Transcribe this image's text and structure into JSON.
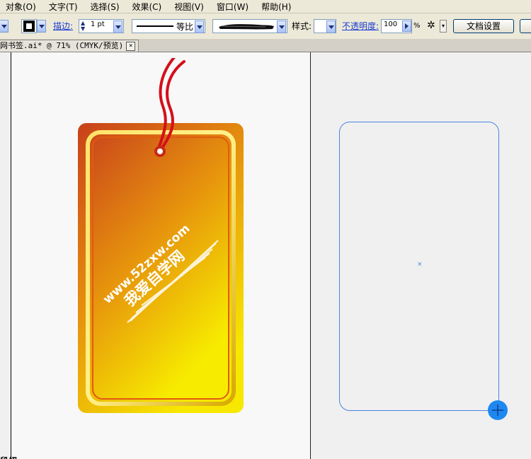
{
  "menu": [
    "对象(O)",
    "文字(T)",
    "选择(S)",
    "效果(C)",
    "视图(V)",
    "窗口(W)",
    "帮助(H)"
  ],
  "controlbar": {
    "stroke_label": "描边:",
    "stroke_weight": "1 pt",
    "profile_label": "等比",
    "style_label": "样式:",
    "opacity_label": "不透明度:",
    "opacity_value": "100",
    "opacity_unit": "%",
    "doc_setup_button": "文档设置"
  },
  "tab": {
    "title": "网书签.ai* @ 71% (CMYK/预览)",
    "close": "×"
  },
  "canvas": {
    "tag_text_line1": "www.52zxw.com",
    "tag_text_line2": "我爱自学网",
    "bottom_label": "段绍"
  },
  "colors": {
    "selection": "#4b83e0",
    "tag_gradient_top": "#c8401a",
    "tag_gradient_bottom": "#f7e800",
    "string": "#d40f1a"
  },
  "icons": [
    "stroke-swatch-icon",
    "stroke-weight-stepper-icon",
    "brush-preview-icon",
    "recolor-artwork-icon"
  ]
}
